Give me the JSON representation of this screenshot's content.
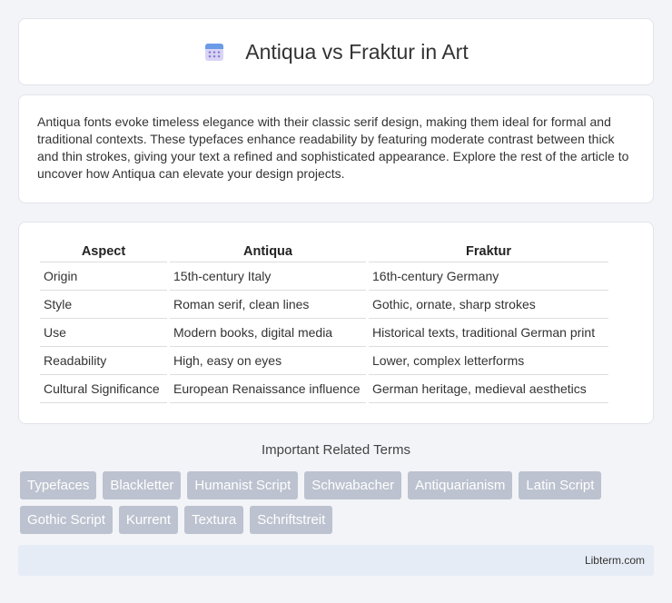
{
  "header": {
    "title": "Antiqua vs Fraktur in Art",
    "icon": "calendar-icon"
  },
  "intro": {
    "text": "Antiqua fonts evoke timeless elegance with their classic serif design, making them ideal for formal and traditional contexts. These typefaces enhance readability by featuring moderate contrast between thick and thin strokes, giving your text a refined and sophisticated appearance. Explore the rest of the article to uncover how Antiqua can elevate your design projects."
  },
  "table": {
    "headers": [
      "Aspect",
      "Antiqua",
      "Fraktur"
    ],
    "rows": [
      [
        "Origin",
        "15th-century Italy",
        "16th-century Germany"
      ],
      [
        "Style",
        "Roman serif, clean lines",
        "Gothic, ornate, sharp strokes"
      ],
      [
        "Use",
        "Modern books, digital media",
        "Historical texts, traditional German print"
      ],
      [
        "Readability",
        "High, easy on eyes",
        "Lower, complex letterforms"
      ],
      [
        "Cultural Significance",
        "European Renaissance influence",
        "German heritage, medieval aesthetics"
      ]
    ]
  },
  "related": {
    "title": "Important Related Terms",
    "tags": [
      "Typefaces",
      "Blackletter",
      "Humanist Script",
      "Schwabacher",
      "Antiquarianism",
      "Latin Script",
      "Gothic Script",
      "Kurrent",
      "Textura",
      "Schriftstreit"
    ]
  },
  "footer": {
    "text": "Libterm.com"
  },
  "colors": {
    "background": "#f3f4f8",
    "tag": "#bcc2cf",
    "footer": "#e6ecf5"
  }
}
